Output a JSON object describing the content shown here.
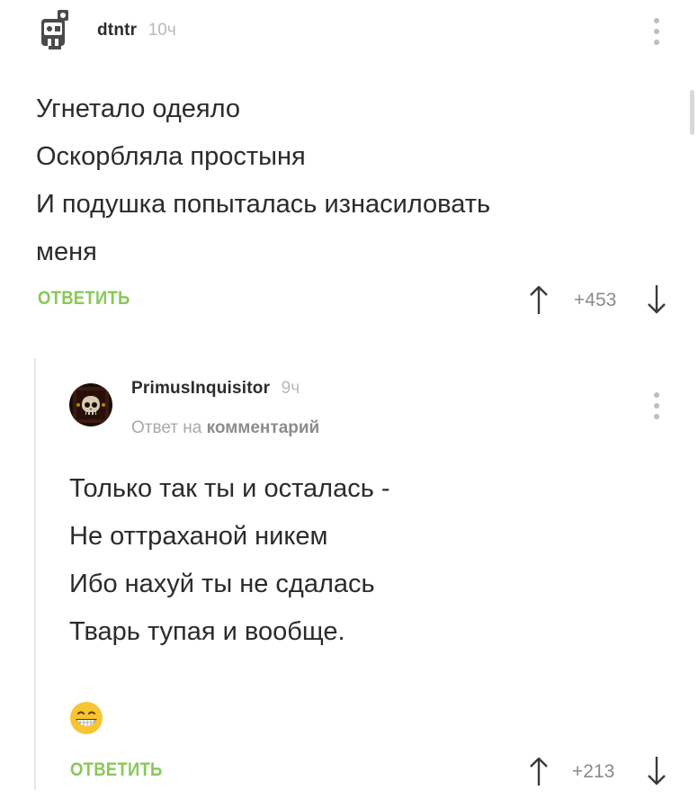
{
  "comment1": {
    "username": "dtntr",
    "time": "10ч",
    "lines": [
      "Угнетало одеяло",
      "Оскорбляла простыня",
      "И подушка попыталась изнасиловать",
      "меня"
    ],
    "reply_label": "ОТВЕТИТЬ",
    "rating": "+453"
  },
  "comment2": {
    "username": "PrimusInquisitor",
    "time": "9ч",
    "reply_to_prefix": "Ответ на",
    "reply_to_target": "комментарий",
    "lines": [
      "Только так ты и осталась -",
      "Не оттраханой никем",
      "Ибо нахуй ты не сдалась",
      "Тварь тупая и вообще."
    ],
    "emoji": "grinning-face-emoji",
    "reply_label": "ОТВЕТИТЬ",
    "rating": "+213"
  },
  "colors": {
    "accent_green": "#8ac858",
    "text": "#2b2b2b",
    "muted": "#b9b9b9"
  }
}
